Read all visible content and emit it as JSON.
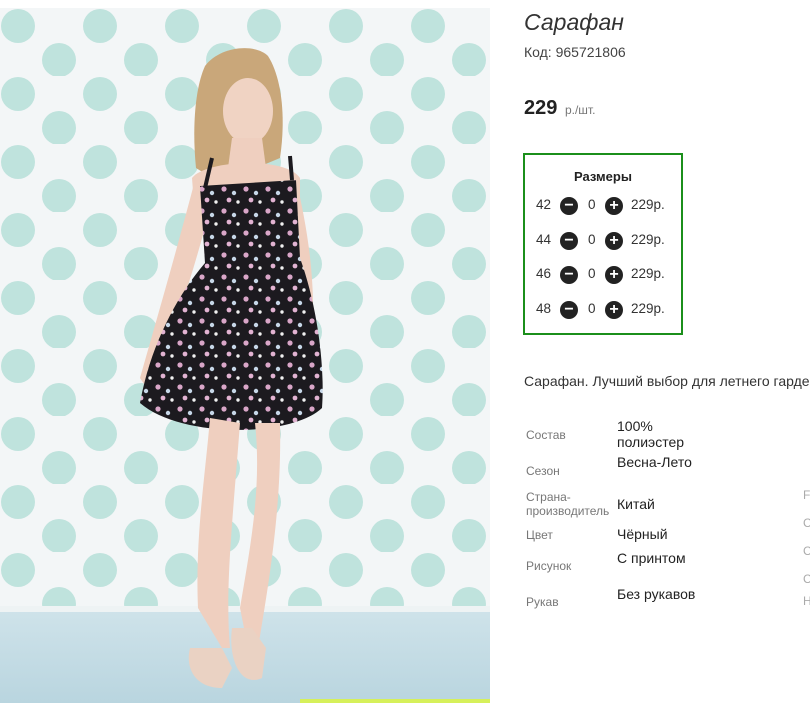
{
  "product": {
    "title": "Сарафан",
    "code_label": "Код:",
    "code": "965721806",
    "price": "229",
    "price_unit": "р./шт."
  },
  "sizes": {
    "title": "Размеры",
    "rows": [
      {
        "size": "42",
        "qty": "0",
        "price": "229р."
      },
      {
        "size": "44",
        "qty": "0",
        "price": "229р."
      },
      {
        "size": "46",
        "qty": "0",
        "price": "229р."
      },
      {
        "size": "48",
        "qty": "0",
        "price": "229р."
      }
    ]
  },
  "description": "Сарафан. Лучший выбор для летнего гардероба",
  "attributes": [
    {
      "name": "Состав",
      "value": "100% полиэстер"
    },
    {
      "name": "Сезон",
      "value": "Весна-Лето"
    },
    {
      "name": "Страна-производитель",
      "value": "Китай"
    },
    {
      "name": "Цвет",
      "value": "Чёрный"
    },
    {
      "name": "Рисунок",
      "value": "С принтом"
    },
    {
      "name": "Рукав",
      "value": "Без рукавов"
    }
  ],
  "faded_column": [
    "F",
    "C",
    "C",
    "C",
    "H"
  ],
  "colors": {
    "sizes_border": "#1b8f1b",
    "dots": "#bfe3dd",
    "dress": "#1c1a1f"
  }
}
